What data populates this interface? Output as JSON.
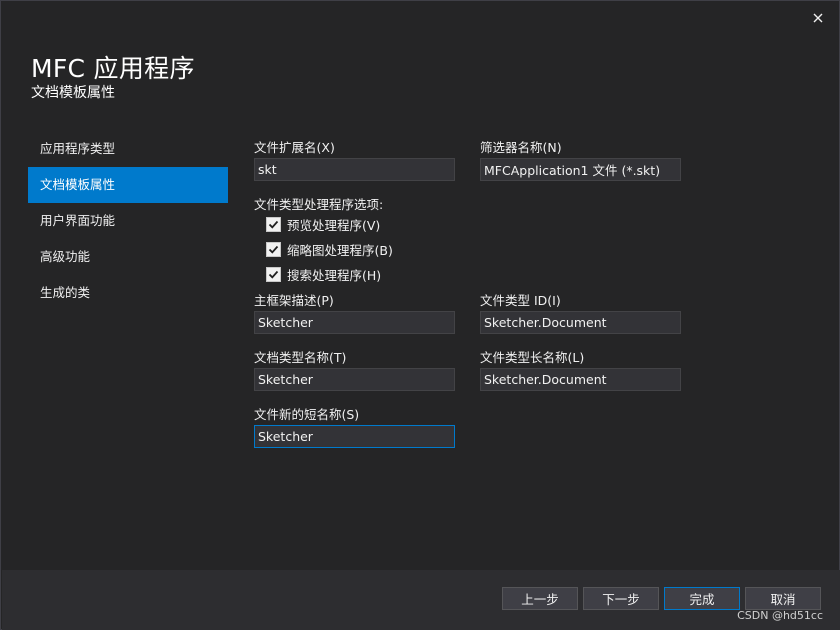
{
  "window": {
    "title": "MFC 应用程序",
    "subtitle": "文档模板属性"
  },
  "nav": {
    "items": [
      {
        "label": "应用程序类型"
      },
      {
        "label": "文档模板属性"
      },
      {
        "label": "用户界面功能"
      },
      {
        "label": "高级功能"
      },
      {
        "label": "生成的类"
      }
    ],
    "active_index": 1
  },
  "fields": {
    "file_ext": {
      "label": "文件扩展名(X)",
      "value": "skt"
    },
    "filter_name": {
      "label": "筛选器名称(N)",
      "value": "MFCApplication1 文件 (*.skt)"
    },
    "main_frame": {
      "label": "主框架描述(P)",
      "value": "Sketcher"
    },
    "file_type_id": {
      "label": "文件类型 ID(I)",
      "value": "Sketcher.Document"
    },
    "doc_type_name": {
      "label": "文档类型名称(T)",
      "value": "Sketcher"
    },
    "file_type_long": {
      "label": "文件类型长名称(L)",
      "value": "Sketcher.Document"
    },
    "new_short_name": {
      "label": "文件新的短名称(S)",
      "value": "Sketcher"
    }
  },
  "handler_options": {
    "label": "文件类型处理程序选项:",
    "preview": {
      "label": "预览处理程序(V)",
      "checked": true
    },
    "thumbnail": {
      "label": "缩略图处理程序(B)",
      "checked": true
    },
    "search": {
      "label": "搜索处理程序(H)",
      "checked": true
    }
  },
  "buttons": {
    "prev": "上一步",
    "next": "下一步",
    "finish": "完成",
    "cancel": "取消"
  },
  "watermark": "CSDN @hd51cc",
  "colors": {
    "accent": "#007acc",
    "background": "#252526",
    "footer": "#2d2d30"
  }
}
